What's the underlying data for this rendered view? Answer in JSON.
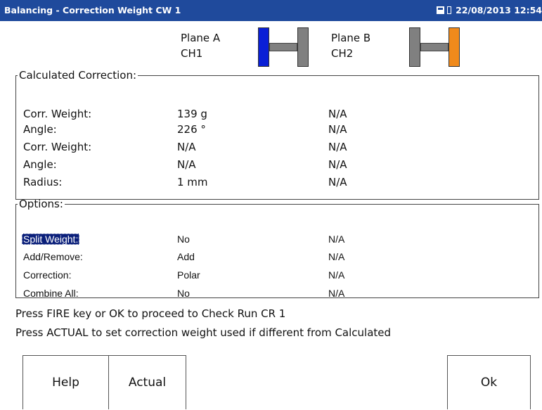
{
  "titlebar": {
    "title": "Balancing - Correction Weight CW 1",
    "datetime": "22/08/2013 12:54",
    "icons": [
      "sd-card-icon",
      "battery-icon"
    ]
  },
  "planes": {
    "a": {
      "name": "Plane A",
      "channel": "CH1",
      "color": "#0a1fd6"
    },
    "b": {
      "name": "Plane B",
      "channel": "CH2",
      "color": "#f08a1c"
    }
  },
  "calculated": {
    "legend": "Calculated Correction:",
    "rows": [
      {
        "label": "Corr. Weight:",
        "a": "139 g",
        "b": "N/A"
      },
      {
        "label": "Angle:",
        "a": "226 °",
        "b": "N/A"
      },
      {
        "label": "Corr. Weight:",
        "a": "N/A",
        "b": "N/A"
      },
      {
        "label": "Angle:",
        "a": "N/A",
        "b": "N/A"
      },
      {
        "label": "Radius:",
        "a": "1 mm",
        "b": "N/A"
      }
    ]
  },
  "options": {
    "legend": "Options:",
    "rows": [
      {
        "label": "Split Weight:",
        "a": "No",
        "b": "N/A",
        "selected": true
      },
      {
        "label": "Add/Remove:",
        "a": "Add",
        "b": "N/A"
      },
      {
        "label": "Correction:",
        "a": "Polar",
        "b": "N/A"
      },
      {
        "label": "Combine All:",
        "a": "No",
        "b": "N/A"
      }
    ]
  },
  "instructions": [
    "Press FIRE key or OK to proceed to Check Run CR 1",
    "Press ACTUAL to set correction weight used if different from Calculated"
  ],
  "buttons": {
    "help": "Help",
    "actual": "Actual",
    "ok": "Ok"
  }
}
